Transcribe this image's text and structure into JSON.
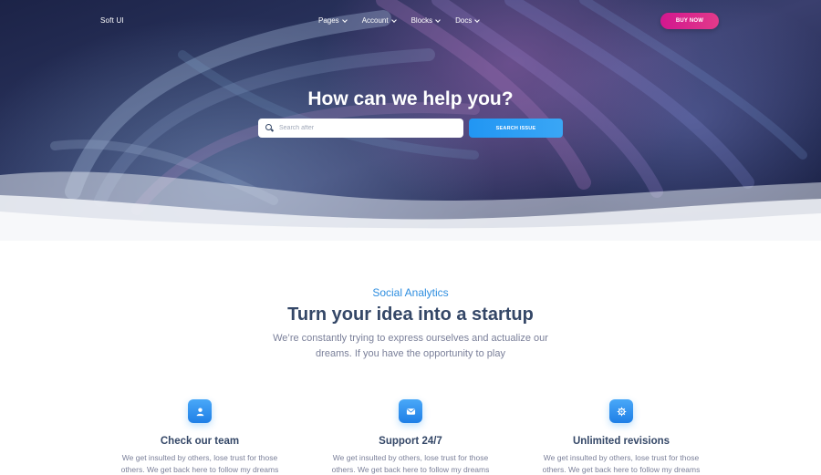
{
  "navbar": {
    "brand": "Soft UI",
    "items": [
      {
        "label": "Pages"
      },
      {
        "label": "Account"
      },
      {
        "label": "Blocks"
      },
      {
        "label": "Docs"
      }
    ],
    "cta_label": "BUY NOW"
  },
  "hero": {
    "title": "How can we help you?",
    "search_placeholder": "Search after",
    "search_button_label": "SEARCH ISSUE"
  },
  "section": {
    "kicker": "Social Analytics",
    "title": "Turn your idea into a startup",
    "description": "We’re constantly trying to express ourselves and actualize our dreams. If you have the opportunity to play"
  },
  "features": [
    {
      "icon": "user-icon",
      "title": "Check our team",
      "description": "We get insulted by others, lose trust for those others. We get back here to follow my dreams"
    },
    {
      "icon": "mail-icon",
      "title": "Support 24/7",
      "description": "We get insulted by others, lose trust for those others. We get back here to follow my dreams"
    },
    {
      "icon": "settings-icon",
      "title": "Unlimited revisions",
      "description": "We get insulted by others, lose trust for those others. We get back here to follow my dreams"
    }
  ],
  "colors": {
    "accent_blue": "#2196f3",
    "cta_pink": "#d2178f",
    "heading": "#344767",
    "muted": "#7b809a"
  }
}
